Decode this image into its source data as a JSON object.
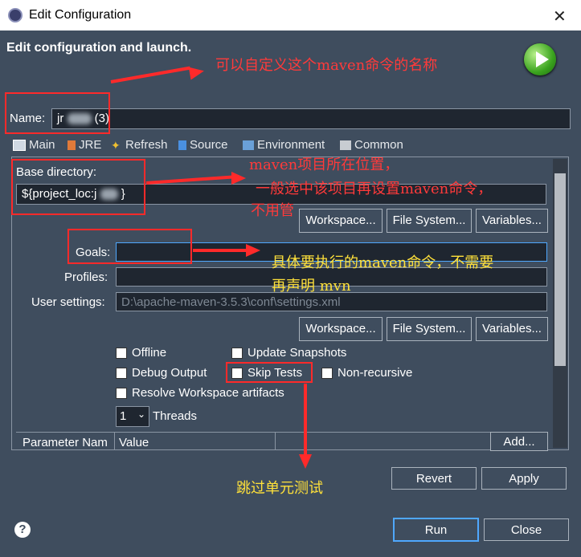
{
  "window": {
    "title": "Edit Configuration",
    "close_glyph": "✕"
  },
  "header": {
    "title": "Edit configuration and launch."
  },
  "name": {
    "label": "Name:",
    "value_prefix": "jr",
    "value_suffix": "(3)"
  },
  "tabs": [
    {
      "label": "Main",
      "icon": "main-tab-icon"
    },
    {
      "label": "JRE",
      "icon": "jre-tab-icon"
    },
    {
      "label": "Refresh",
      "icon": "refresh-tab-icon"
    },
    {
      "label": "Source",
      "icon": "source-tab-icon"
    },
    {
      "label": "Environment",
      "icon": "environment-tab-icon"
    },
    {
      "label": "Common",
      "icon": "common-tab-icon"
    }
  ],
  "main": {
    "base_dir_label": "Base directory:",
    "base_dir_value": "${project_loc:j",
    "base_dir_suffix": "}",
    "buttons1": {
      "workspace": "Workspace...",
      "filesystem": "File System...",
      "variables": "Variables..."
    },
    "goals_label": "Goals:",
    "goals_value": "",
    "profiles_label": "Profiles:",
    "profiles_value": "",
    "user_settings_label": "User settings:",
    "user_settings_value": "D:\\apache-maven-3.5.3\\conf\\settings.xml",
    "buttons2": {
      "workspace": "Workspace...",
      "filesystem": "File System...",
      "variables": "Variables..."
    },
    "checkboxes": {
      "offline": "Offline",
      "update_snapshots": "Update Snapshots",
      "debug_output": "Debug Output",
      "skip_tests": "Skip Tests",
      "non_recursive": "Non-recursive",
      "resolve_workspace": "Resolve Workspace artifacts"
    },
    "threads_value": "1",
    "threads_label": "Threads",
    "table": {
      "col1": "Parameter Nam",
      "col2": "Value",
      "add_button": "Add..."
    }
  },
  "footer": {
    "revert": "Revert",
    "apply": "Apply",
    "run": "Run",
    "close": "Close",
    "help_glyph": "?"
  },
  "annotations": {
    "name_note": "可以自定义这个maven命令的名称",
    "base_dir_note_1": "maven项目所在位置，",
    "base_dir_note_2": "一般选中该项目再设置maven命令，",
    "base_dir_note_3": "不用管",
    "goals_note_1": "具体要执行的maven命令，不需要",
    "goals_note_2": "再声明 mvn",
    "skip_tests_note": "跳过单元测试"
  }
}
